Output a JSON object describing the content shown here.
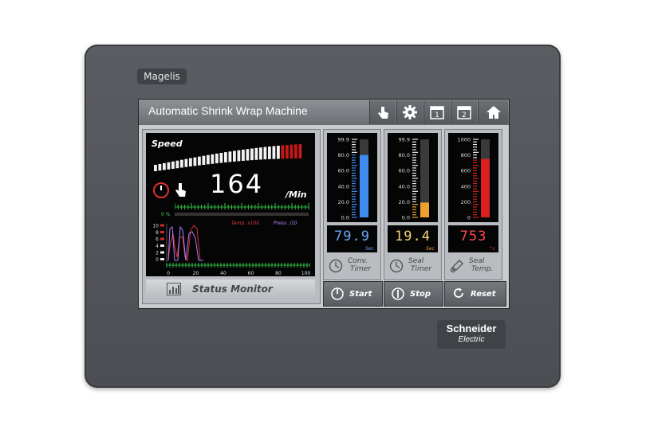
{
  "device": {
    "brand": "Magelis",
    "logo_line1": "Schneider",
    "logo_line2": "Electric"
  },
  "header": {
    "title": "Automatic Shrink Wrap Machine",
    "icons": [
      "touch-hand-icon",
      "gear-icon",
      "calendar-1-icon",
      "calendar-2-icon",
      "home-icon"
    ],
    "calendar1": "1",
    "calendar2": "2"
  },
  "speed": {
    "label": "Speed",
    "value": "164",
    "unit": "/Min",
    "percent_label": "0 %",
    "legend_temp": "Temp. x100",
    "legend_press": "Press. /10"
  },
  "trend": {
    "y_ticks": [
      "10",
      "8",
      "6",
      "4",
      "2",
      "0"
    ],
    "x_ticks": [
      "0",
      "20",
      "40",
      "60",
      "80",
      "100"
    ]
  },
  "status_monitor": {
    "label": "Status Monitor"
  },
  "gauges": [
    {
      "id": "conv",
      "ticks": [
        "99.9",
        "80.0",
        "60.0",
        "40.0",
        "20.0",
        "0.0"
      ],
      "fill": 0.8,
      "color": "#3f8cf0",
      "value": "79.9",
      "unit": "Sec",
      "value_color": "#6aa8ff",
      "caption1": "Conv.",
      "caption2": "Timer"
    },
    {
      "id": "seal",
      "ticks": [
        "99.9",
        "80.0",
        "60.0",
        "40.0",
        "20.0",
        "0.0"
      ],
      "fill": 0.19,
      "color": "#f0a030",
      "value": "19.4",
      "unit": "Sec",
      "value_color": "#f5d27a",
      "caption1": "Seal",
      "caption2": "Timer"
    },
    {
      "id": "temp",
      "ticks": [
        "1000",
        "800",
        "600",
        "400",
        "200",
        "0"
      ],
      "fill": 0.75,
      "color": "#d82020",
      "value": "753",
      "unit": "°c",
      "value_color": "#ff4a4a",
      "caption1": "Seal",
      "caption2": "Temp."
    }
  ],
  "controls": {
    "start": "Start",
    "stop": "Stop",
    "reset": "Reset"
  },
  "colors": {
    "screen_bg": "#c9cbcd",
    "bezel": "#505357",
    "accent_green": "#35c24a"
  }
}
